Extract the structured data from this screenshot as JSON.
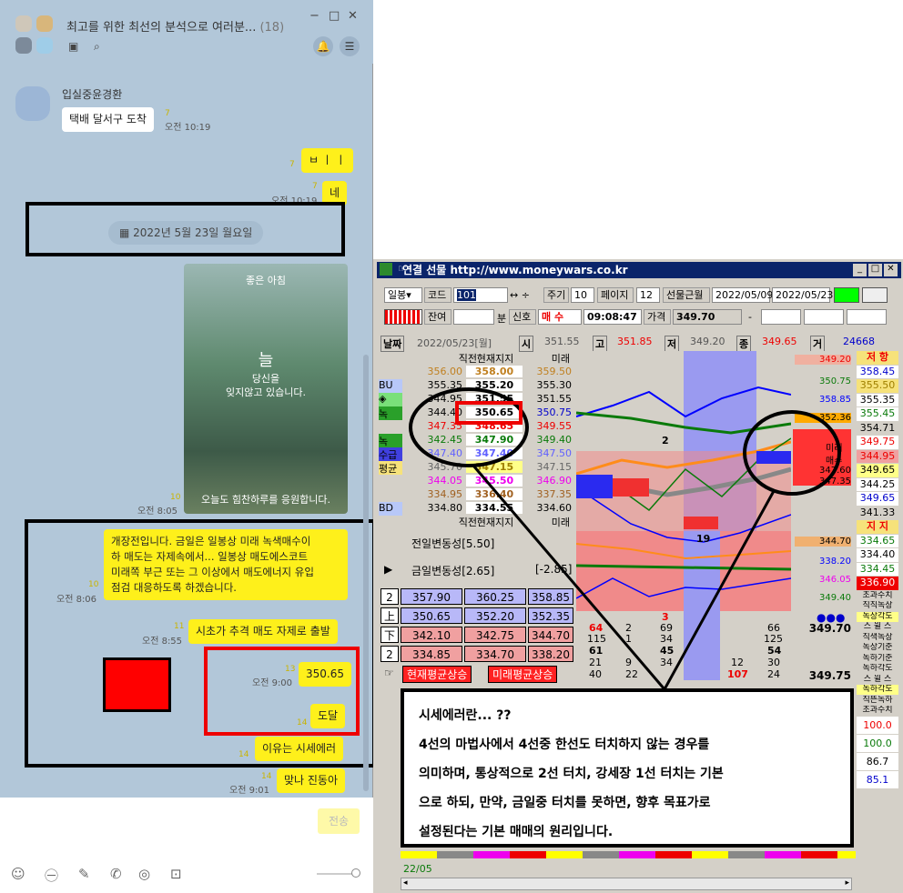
{
  "chat": {
    "title": "최고를 위한 최선의 분석으로 여러분...",
    "member_count": "(18)",
    "sender": "입실중윤경환",
    "messages": [
      {
        "text": "택배 달서구 도착",
        "unread": "7",
        "time": "오전 10:19"
      },
      {
        "text": "ㅂ ㅣ ㅣ",
        "unread": "7"
      },
      {
        "text": "네",
        "unread": "7",
        "time": "오전 10:19"
      },
      {
        "text": "2022년 5월 23일 월요일"
      },
      {
        "unread": "10",
        "time": "오전 8:05",
        "photo_texts": [
          "좋은 아침",
          "늘",
          "당신을",
          "잊지않고 있습니다.",
          "오늘도 힘찬하루를 응원합니다."
        ]
      },
      {
        "text": "개장전입니다. 금일은 일봉상 미래 녹색매수이하  매도는 자제속에서... 일봉상 매도에스코트 미래쪽 부근 또는 그 이상에서 매도에너지 유입 점검 대응하도록 하겠습니다.",
        "lines": [
          "개장전입니다. 금일은 일봉상 미래 녹색매수이",
          "하  매도는 자제속에서... 일봉상 매도에스코트",
          "미래쪽 부근 또는 그 이상에서 매도에너지 유입",
          "점검 대응하도록 하겠습니다."
        ],
        "unread": "10",
        "time": "오전 8:06"
      },
      {
        "text": "시초가 추격 매도 자제로 출발",
        "unread": "11",
        "time": "오전 8:55"
      },
      {
        "text": "350.65",
        "unread": "13",
        "time": "오전 9:00"
      },
      {
        "text": "도달",
        "unread": "14"
      },
      {
        "text": "이유는 시세에러",
        "unread": "14"
      },
      {
        "text": "맞나 진동아",
        "unread": "14",
        "time": "오전 9:01"
      }
    ],
    "send_label": "전송"
  },
  "trading": {
    "window_title": "연결 선물  http://www.moneywars.co.kr",
    "toolbar": {
      "daily": "일봉",
      "code_label": "코드",
      "code": "101",
      "cycle_label": "주기",
      "cycle": "10",
      "page_label": "페이지",
      "page": "12",
      "contract": "선물근월",
      "date_from": "2022/05/09",
      "date_to": "2022/05/23",
      "remain_label": "잔여",
      "min_label": "분",
      "signal_label": "신호",
      "signal": "매 수",
      "time": "09:08:47",
      "price_label": "가격",
      "price": "349.70",
      "dash": "-"
    },
    "date_bar": {
      "label": "날짜",
      "date": "2022/05/23[월]",
      "open_label": "시",
      "open": "351.55",
      "high_label": "고",
      "high": "351.85",
      "low_label": "저",
      "low": "349.20",
      "close_label": "종",
      "close": "349.65",
      "vol_label": "거",
      "vol": "24668"
    },
    "table_header": [
      "직전",
      "현재지지",
      "미래"
    ],
    "table_rows": [
      {
        "tag": "",
        "a": "356.00",
        "b": "358.00",
        "c": "359.50"
      },
      {
        "tag": "BU",
        "a": "355.35",
        "b": "355.20",
        "c": "355.30"
      },
      {
        "tag": "◈",
        "a": "344.95",
        "b": "351.55",
        "c": "351.55"
      },
      {
        "tag": "녹",
        "a": "344.40",
        "b": "350.65",
        "c": "350.75"
      },
      {
        "tag": "",
        "a": "347.35",
        "b": "348.65",
        "c": "349.55"
      },
      {
        "tag": "녹",
        "a": "342.45",
        "b": "347.90",
        "c": "349.40"
      },
      {
        "tag": "수급",
        "a": "347.40",
        "b": "347.40",
        "c": "347.50"
      },
      {
        "tag": "평균",
        "a": "345.70",
        "b": "347.15",
        "c": "347.15"
      },
      {
        "tag": "",
        "a": "344.05",
        "b": "345.50",
        "c": "346.90"
      },
      {
        "tag": "",
        "a": "334.95",
        "b": "336.40",
        "c": "337.35"
      },
      {
        "tag": "BD",
        "a": "334.80",
        "b": "334.55",
        "c": "334.60"
      }
    ],
    "vol_prev": "전일변동성[5.50]",
    "vol_today": "금일변동성[2.65]",
    "vol_diff": "[-2.85]",
    "pivot_rows": [
      {
        "tag": "2",
        "a": "357.90",
        "b": "360.25",
        "c": "358.85"
      },
      {
        "tag": "上",
        "a": "350.65",
        "b": "352.20",
        "c": "352.35"
      },
      {
        "tag": "下",
        "a": "342.10",
        "b": "342.75",
        "c": "344.70"
      },
      {
        "tag": "2",
        "a": "334.85",
        "b": "334.70",
        "c": "338.20"
      }
    ],
    "status_left": "현재평균상승",
    "status_right": "미래평균상승",
    "chart_labels": [
      "2",
      "19",
      "미래",
      "매수"
    ],
    "chart_counts": [
      "3",
      "64",
      "2",
      "69",
      "66",
      "115",
      "1",
      "34",
      "125",
      "61",
      "45",
      "54",
      "21",
      "9",
      "34",
      "12",
      "30",
      "40",
      "22",
      "107",
      "24"
    ],
    "chart_right_vals": [
      "349.20",
      "350.75",
      "358.85",
      "352.36",
      "347.60",
      "347.35",
      "344.70",
      "338.20",
      "346.05",
      "349.40",
      "349.70",
      "349.75"
    ],
    "right_panel": [
      "저 항",
      "358.45",
      "355.50",
      "355.35",
      "355.45",
      "354.71",
      "349.75",
      "344.95",
      "349.65",
      "344.25",
      "349.65",
      "341.33",
      "지 지",
      "334.65",
      "334.40",
      "334.45",
      "336.90",
      "초과수치",
      "직직녹상",
      "녹상각도",
      "스 윌 스",
      "직색녹상",
      "녹상기준",
      "녹하기준",
      "녹하각도",
      "스 윌 스",
      "녹하각도",
      "직뜬녹하",
      "초과수치",
      "100.0",
      "100.0",
      "86.7",
      "85.1"
    ],
    "note_lines": [
      "시세에러란... ??",
      "4선의 마법사에서 4선중 한선도 터치하지 않는 경우를",
      "의미하며, 통상적으로 2선 터치, 강세장 1선 터치는 기본",
      "으로 하되, 만약, 금일중 터치를 못하면, 향후 목표가로",
      "설정된다는 기본 매매의 원리입니다."
    ],
    "bottom_date": "22/05",
    "colors": {
      "titlebar": "#0a246a",
      "kakao_yellow": "#fef01b",
      "chat_bg": "#b2c7d9"
    }
  }
}
